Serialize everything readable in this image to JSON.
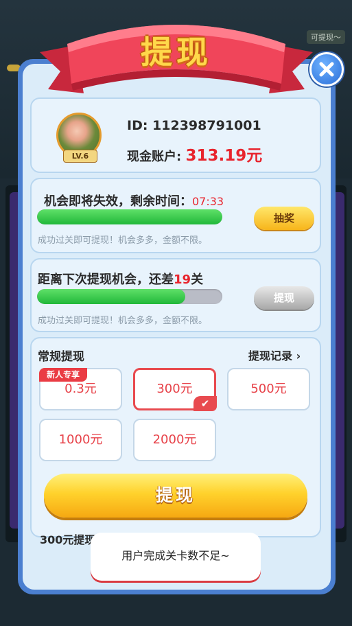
{
  "background": {
    "top_right_label": "可提现～"
  },
  "header": {
    "title": "提现",
    "close_icon": "close-x-icon"
  },
  "user": {
    "level": "LV.6",
    "id_text": "ID: 112398791001",
    "account_label": "现金账户: ",
    "account_value": "313.19元"
  },
  "lottery": {
    "title": "机会即将失效，剩余时间：",
    "countdown": "07:33",
    "progress": 1.0,
    "button_label": "抽奖",
    "hint": "成功过关即可提现！机会多多，金额不限。"
  },
  "next_withdraw": {
    "title_prefix": "距离下次提现机会，还差",
    "levels_left": "19",
    "title_suffix": "关",
    "progress": 0.8,
    "button_label": "提现",
    "hint": "成功过关即可提现！机会多多，金额不限。"
  },
  "regular": {
    "title": "常规提现",
    "records_link": "提现记录",
    "records_icon": "chevron-right-icon",
    "new_user_tag": "新人专享",
    "options": [
      "0.3元",
      "300元",
      "500元",
      "1000元",
      "2000元"
    ],
    "selected": "300元",
    "check_icon": "checkmark-icon"
  },
  "withdraw_button": "提现",
  "partial_text": "300元提现",
  "toast": "用户完成关卡数不足~",
  "colors": {
    "accent_red": "#e8242d",
    "panel_blue": "#4b7fd0",
    "button_yellow": "#ffd22c",
    "progress_green": "#2ec447"
  }
}
